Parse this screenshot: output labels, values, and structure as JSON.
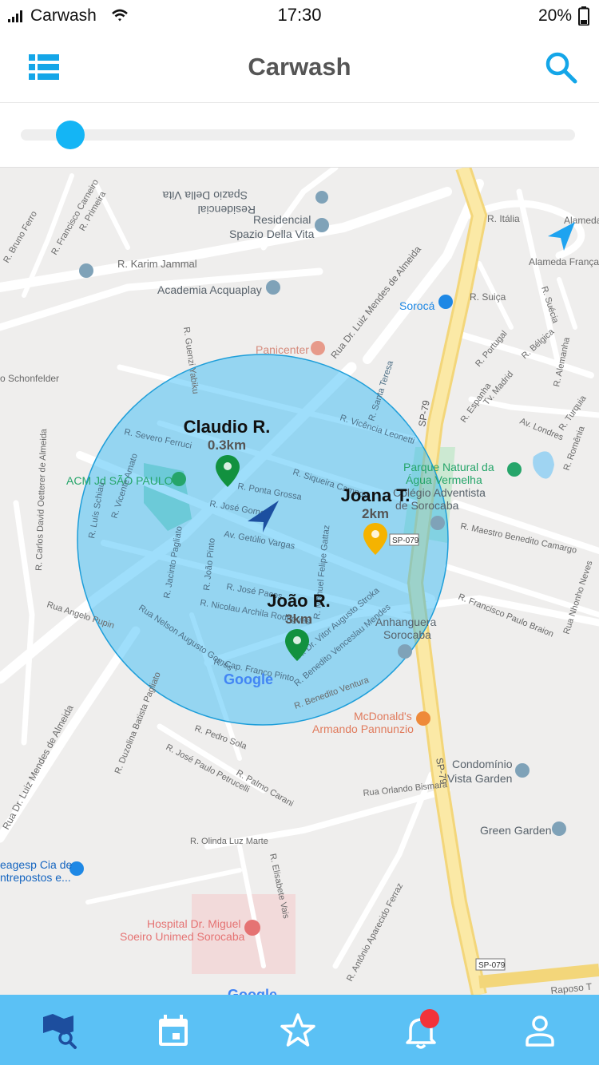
{
  "status_bar": {
    "carrier": "Carwash",
    "time": "17:30",
    "battery": "20%"
  },
  "header": {
    "title": "Carwash",
    "menu_icon": "list-icon",
    "search_icon": "search-icon"
  },
  "slider": {
    "level": 0.09,
    "color": "#14b5f5"
  },
  "map": {
    "watermark": "Google",
    "watermark_bottom": "Google",
    "radius_color": "#29b6f6",
    "labels": {
      "street_karim": "R. Karim Jammal",
      "academia": "Academia Acquaplay",
      "residencial": "Residencial",
      "spazio": "Spazio Della Vita",
      "spazio_flip": "Spazio Della Vita",
      "residencial_flip": "Residencial",
      "italia": "R. Itália",
      "alameda_franca": "Alameda França",
      "alameda_d": "Alameda d",
      "sorocaba_shop": "Sorocá",
      "suica": "R. Suiça",
      "panicenter": "Panicenter",
      "luiz_mendes_top": "Rua Dr. Luiz Mendes de Almeida",
      "schonfelder": "o Schonfelder",
      "acm": "ACM Jd SÃO PAULO",
      "parque_1": "Parque Natural da",
      "parque_2": "Água Vermelha",
      "adventista_1": "Colégio Adventista",
      "adventista_2": "de Sorocaba",
      "sp079_badge_1": "SP-079",
      "sp079_badge_2": "SP-079",
      "sp79_road": "SP-79",
      "sp79_road_2": "SP-79",
      "maestro": "R. Maestro Benedito Camargo",
      "anhanguera_1": "Anhanguera",
      "anhanguera_2": "Sorocaba",
      "mcdonalds_1": "McDonald's",
      "mcdonalds_2": "Armando Pannunzio",
      "condominio_1": "Condomínio",
      "condominio_2": "Vista Garden",
      "green_garden": "Green Garden",
      "orlando": "Rua Orlando Bismara",
      "olinda": "R. Olinda Luz Marte",
      "hospital_1": "Hospital Dr. Miguel",
      "hospital_2": "Soeiro Unimed Sorocaba",
      "ceagesp_1": "eagesp Cia de",
      "ceagesp_2": "ntrepostos e...",
      "angelo": "Rua Angelo Pupin",
      "luiz_mendes_bottom": "Rua Dr. Luiz Mendes de Almeida",
      "raposo": "Raposo T",
      "pedro_sola": "R. Pedro Sola",
      "palmo": "R. Palmo Carani",
      "jose_petrucelli": "R. José Paulo Petrucelli",
      "duzolina": "R. Duzolina Batista Pagliato",
      "elisabete": "R. Elisabete Vais",
      "antonio": "R. Antônio Aparecido Ferraz",
      "benedito_ventura": "R. Benedito Ventura",
      "francisco_braion": "R. Francisco Paulo Braion",
      "nhonho": "Rua Nhonho Neves",
      "carlos_oetterer": "R. Carlos David Oetterer de Almeida",
      "severo": "R. Severo Ferruci",
      "siqueira": "R. Siqueira Campos",
      "vicencia": "R. Vicência Leonetti",
      "santa_teresa": "R. Santa Teresa",
      "getulio": "Av. Getúlio Vargas",
      "jose_pacos": "R. José Pacos",
      "nicolau": "R. Nicolau Archila Rodrigues",
      "nelson": "Rua Nelson Augusto Gomes",
      "cap_franco": "R. Cap. Franco Pinto",
      "vitor": "R. Dr. Vitor Augusto Stroka",
      "venceslau": "R. Benedito Venceslau Mendes",
      "manuel": "R. Manuel Felipe Gattaz",
      "ponta_grossa": "R. Ponta Grossa",
      "jose_gom": "R. José Gomes",
      "joao_pinto": "R. João Pinto",
      "jacinto": "R. Jacinto Pagliato",
      "vicente": "R. Vicente Amato",
      "luis_schiau": "R. Luís Schiau",
      "guenzi": "R. Guenzi Yabiku",
      "bruno_ferro": "R. Bruno Ferro",
      "francisco_carn": "R. Francisco Carneiro",
      "primeira": "R. Primeira",
      "portugal": "R. Portugal",
      "belgica": "R. Bélgica",
      "alemanha": "R. Alemanha",
      "espanha": "R. Espanha",
      "madrid": "Tv. Madrid",
      "londres": "Av. Londres",
      "turquia": "R. Turquia",
      "romania": "R. Romênia",
      "suecia": "R. Suécia"
    },
    "markers": [
      {
        "name": "Claudio R.",
        "distance": "0.3km",
        "color": "#12913f"
      },
      {
        "name": "Joana T.",
        "distance": "2km",
        "color": "#f5b300"
      },
      {
        "name": "João R.",
        "distance": "3km",
        "color": "#12913f"
      }
    ]
  },
  "tabbar": {
    "background": "#5bc1f5",
    "tabs": [
      {
        "icon": "map-search-icon",
        "active": true
      },
      {
        "icon": "calendar-icon",
        "active": false
      },
      {
        "icon": "star-icon",
        "active": false
      },
      {
        "icon": "bell-icon",
        "active": false,
        "badge": true
      },
      {
        "icon": "profile-icon",
        "active": false
      }
    ]
  }
}
